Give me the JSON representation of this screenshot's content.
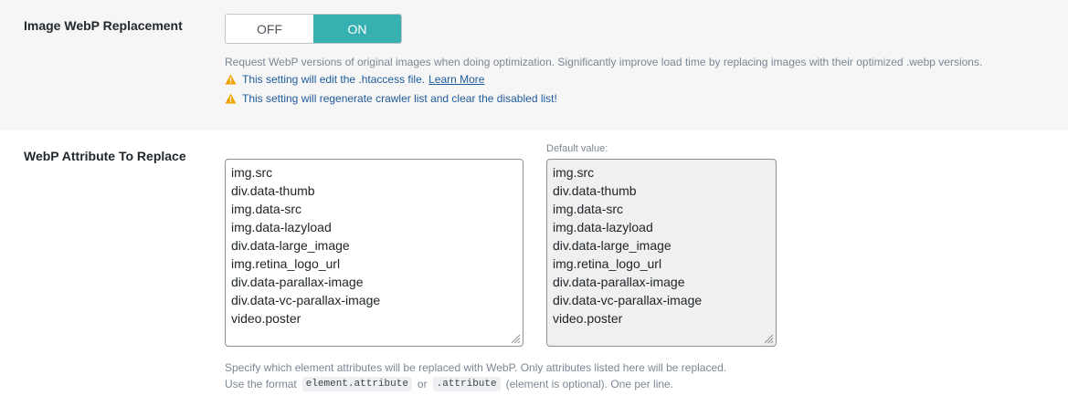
{
  "webp_replacement": {
    "label": "Image WebP Replacement",
    "toggle": {
      "off_label": "OFF",
      "on_label": "ON",
      "selected": "ON"
    },
    "description": "Request WebP versions of original images when doing optimization. Significantly improve load time by replacing images with their optimized .webp versions.",
    "warning_1": "This setting will edit the .htaccess file.",
    "learn_more": "Learn More",
    "warning_2": "This setting will regenerate crawler list and clear the disabled list!"
  },
  "webp_attribute": {
    "label": "WebP Attribute To Replace",
    "default_label": "Default value:",
    "current_lines": [
      "img.src",
      "div.data-thumb",
      "img.data-src",
      "img.data-lazyload",
      "div.data-large_image",
      "img.retina_logo_url",
      "div.data-parallax-image",
      "div.data-vc-parallax-image",
      "video.poster"
    ],
    "default_lines": [
      "img.src",
      "div.data-thumb",
      "img.data-src",
      "img.data-lazyload",
      "div.data-large_image",
      "img.retina_logo_url",
      "div.data-parallax-image",
      "div.data-vc-parallax-image",
      "video.poster"
    ],
    "help_1": "Specify which element attributes will be replaced with WebP. Only attributes listed here will be replaced.",
    "help_2_prefix": "Use the format",
    "help_2_code_1": "element.attribute",
    "help_2_or": "or",
    "help_2_code_2": ".attribute",
    "help_2_suffix": "(element is optional). One per line."
  },
  "colors": {
    "accent": "#36b0b0",
    "warning": "#f0a202",
    "link": "#1e5b9b"
  },
  "icons": {
    "warning": "warning-triangle-icon",
    "resize": "resize-grip-icon"
  }
}
